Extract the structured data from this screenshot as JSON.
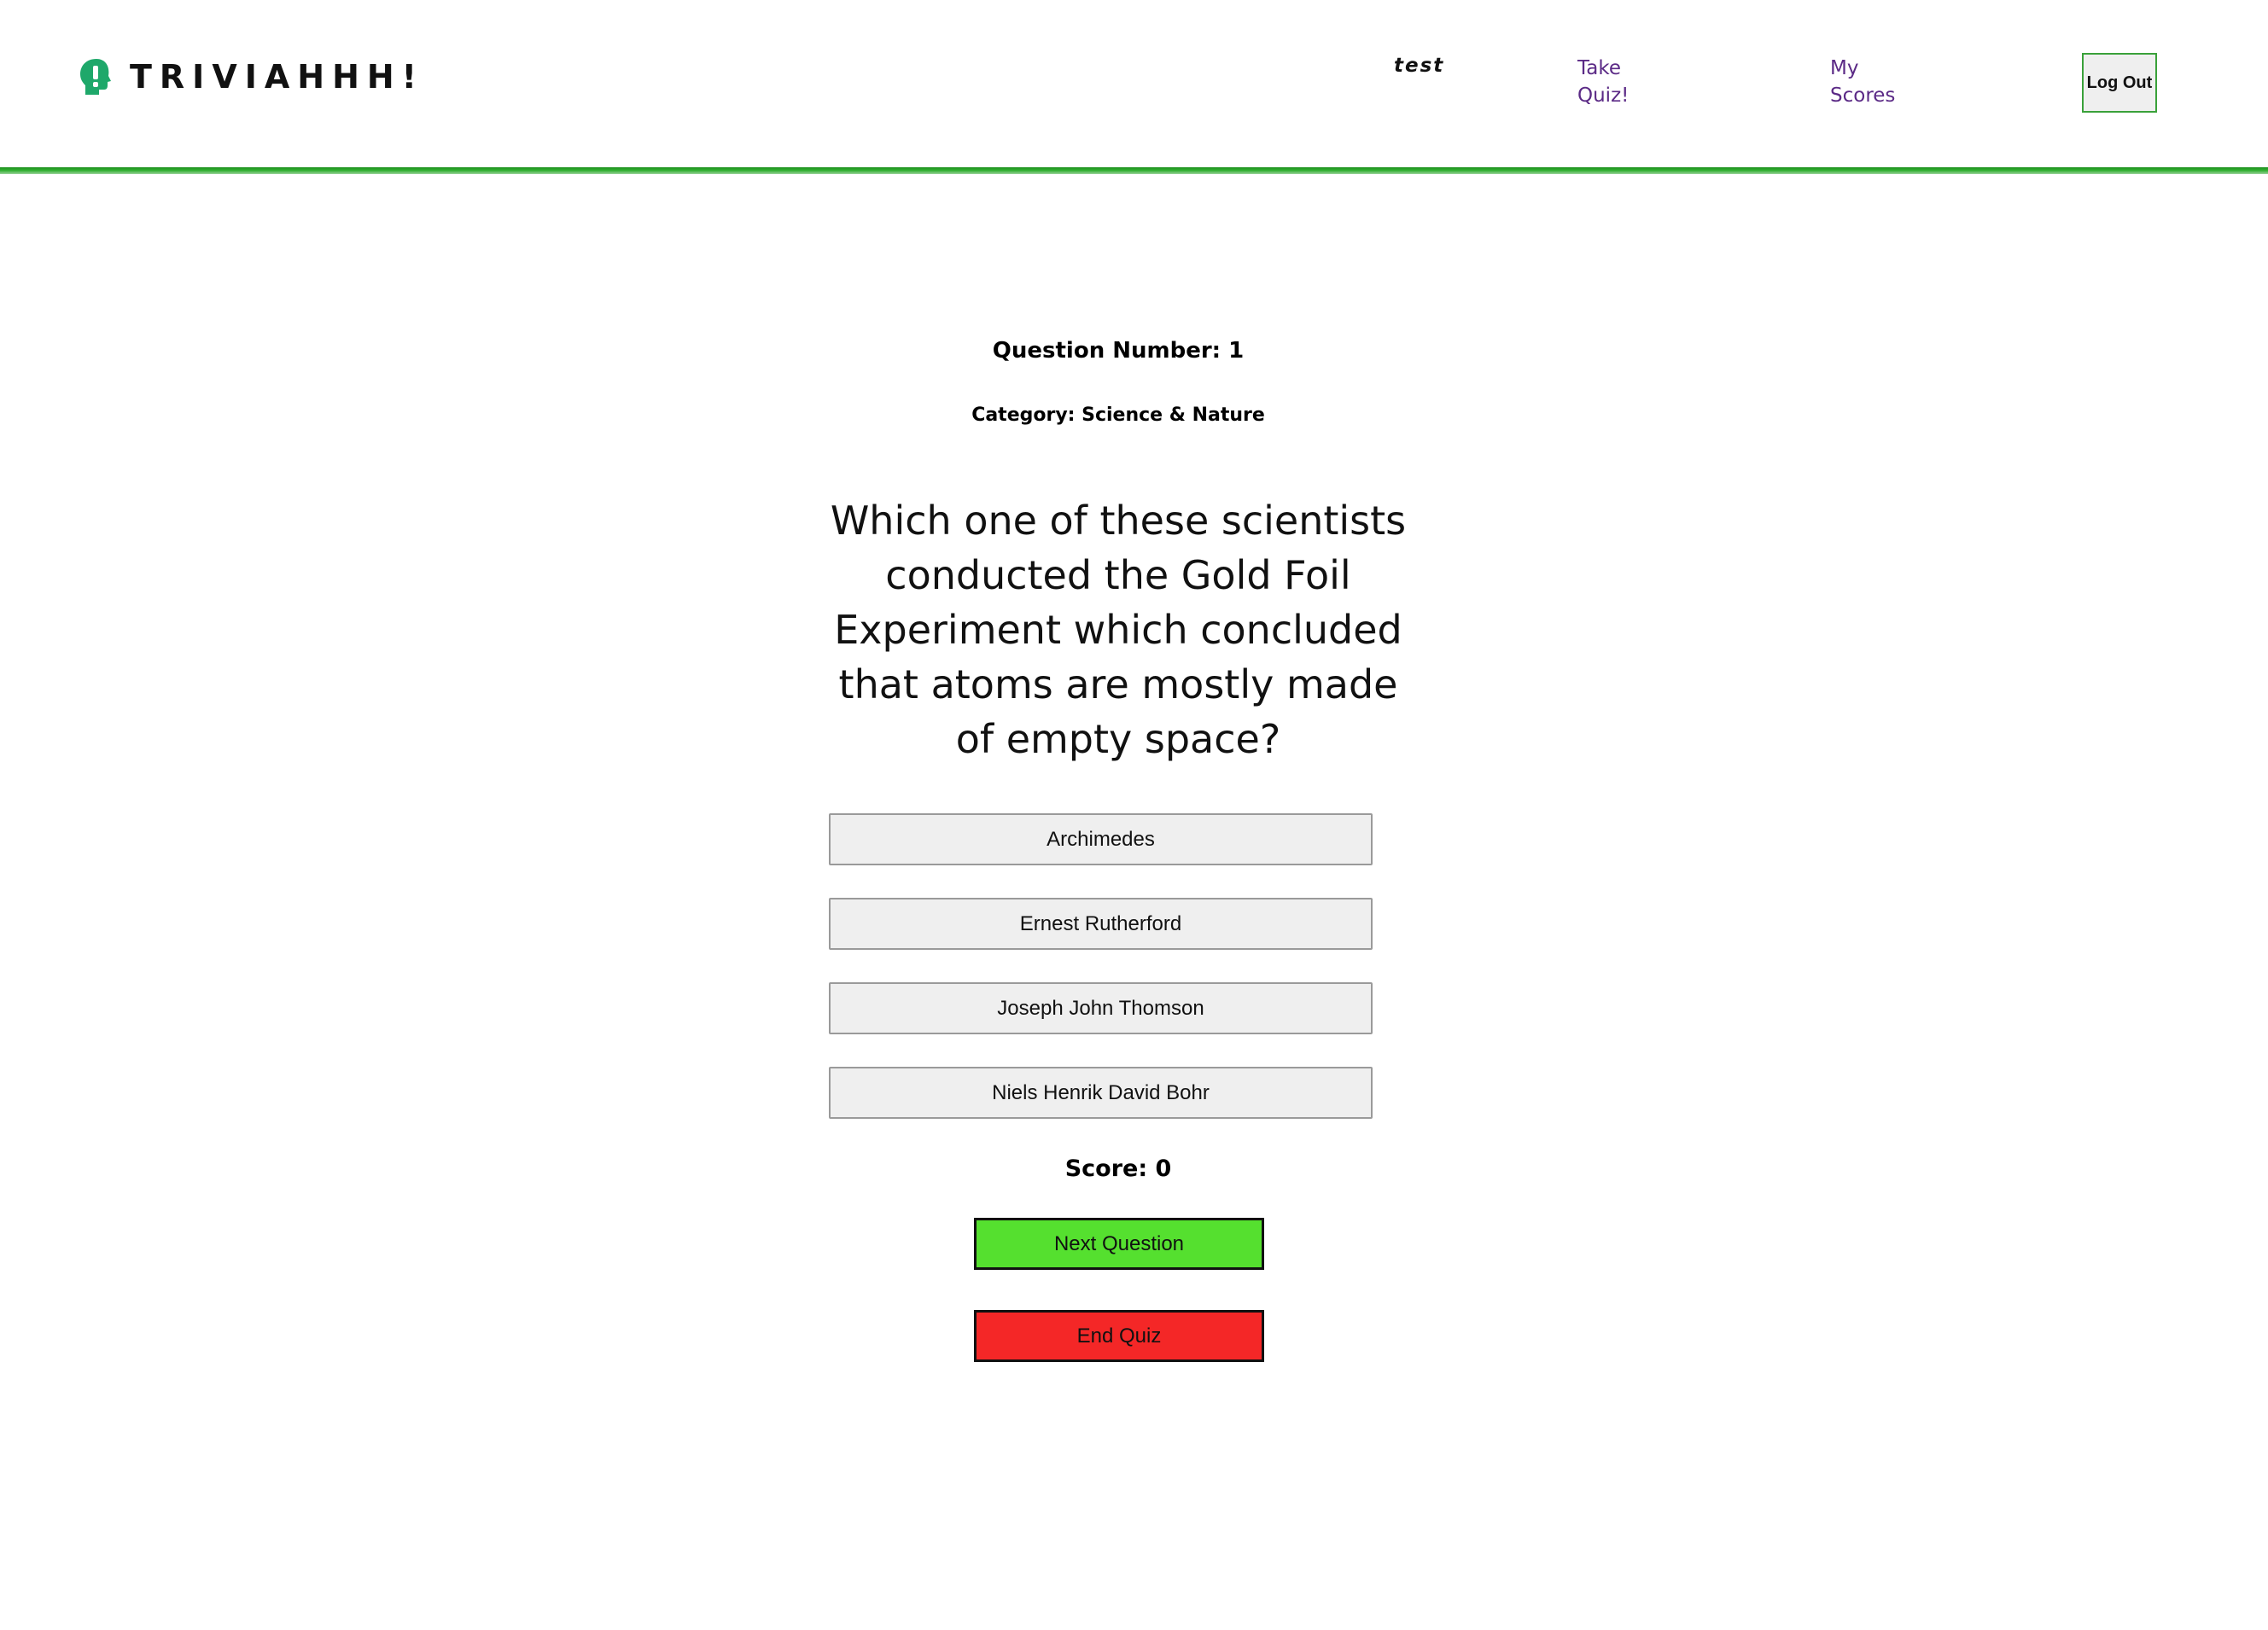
{
  "header": {
    "logo_text": "TRIVIAHHH!",
    "logo_icon": "head-exclamation-icon",
    "user": "test",
    "nav": {
      "take_quiz": "Take Quiz!",
      "my_scores": "My Scores"
    },
    "logout_label": "Log Out"
  },
  "colors": {
    "header_bar": "#2fae2f",
    "nav_link": "#5b2a86",
    "logo_green": "#1ea86a",
    "next_button": "#55e02f",
    "end_button": "#f42727"
  },
  "quiz": {
    "question_number": "Question Number: 1",
    "category": "Category: Science & Nature",
    "question": "Which one of these scientists conducted the Gold Foil Experiment which concluded that atoms are mostly made of empty space?",
    "answers": [
      "Archimedes",
      "Ernest Rutherford",
      "Joseph John Thomson",
      "Niels Henrik David Bohr"
    ],
    "score": "Score: 0",
    "next_label": "Next Question",
    "end_label": "End Quiz"
  }
}
